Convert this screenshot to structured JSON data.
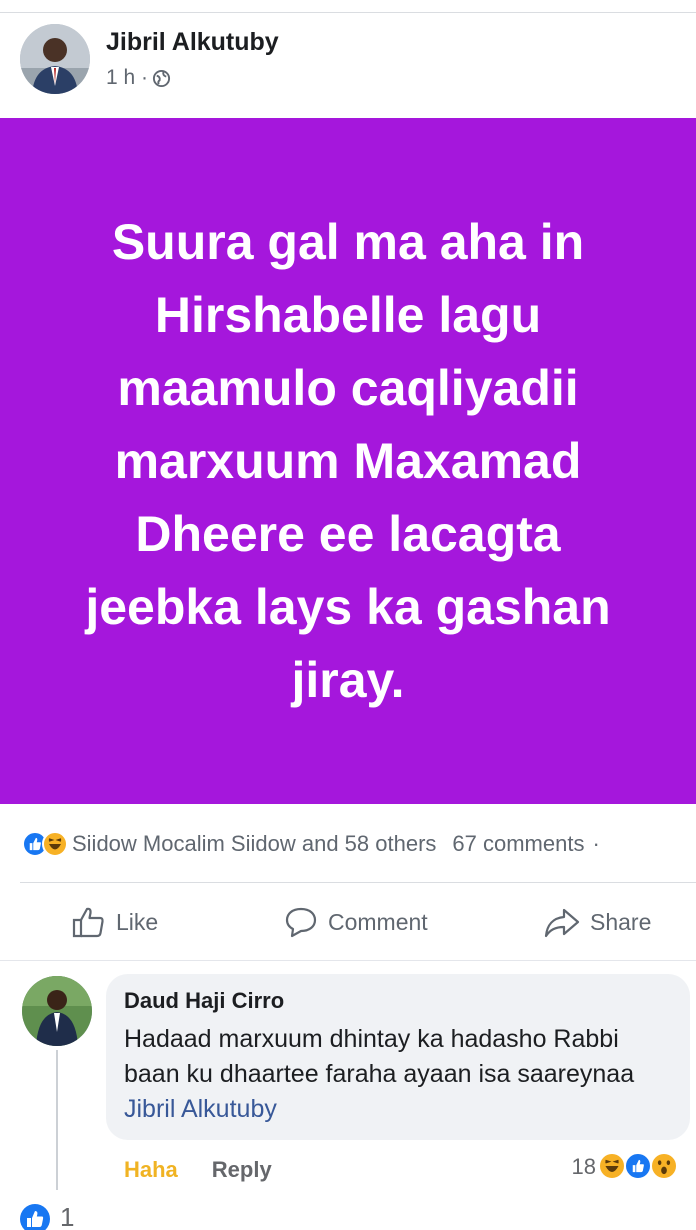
{
  "post": {
    "author": "Jibril Alkutuby",
    "time": "1 h ·",
    "privacy_icon": "globe-icon",
    "banner_text": "Suura gal ma aha in\nHirshabelle lagu\nmaamulo caqliyadii\nmarxuum Maxamad\nDheere ee lacagta\njeebka lays ka gashan\njiray.",
    "banner_color": "#a517dc"
  },
  "reactions": {
    "icons": [
      "like-icon",
      "haha-icon"
    ],
    "summary": "Siidow Mocalim Siidow and 58 others",
    "comments": "67 comments",
    "separator": "·"
  },
  "actions": {
    "like": "Like",
    "comment": "Comment",
    "share": "Share"
  },
  "comment": {
    "author": "Daud Haji Cirro",
    "text": "Hadaad marxuum dhintay ka hadasho Rabbi baan ku dhaartee faraha ayaan isa saareynaa",
    "mention": "Jibril Alkutuby",
    "haha_label": "Haha",
    "reply_label": "Reply",
    "reaction_count": "18",
    "reaction_icons": [
      "haha-icon",
      "like-icon",
      "wow-icon"
    ]
  },
  "footer": {
    "like_count": "1"
  },
  "colors": {
    "accent": "#1877f2",
    "haha": "#f0b323",
    "mention": "#385898"
  }
}
